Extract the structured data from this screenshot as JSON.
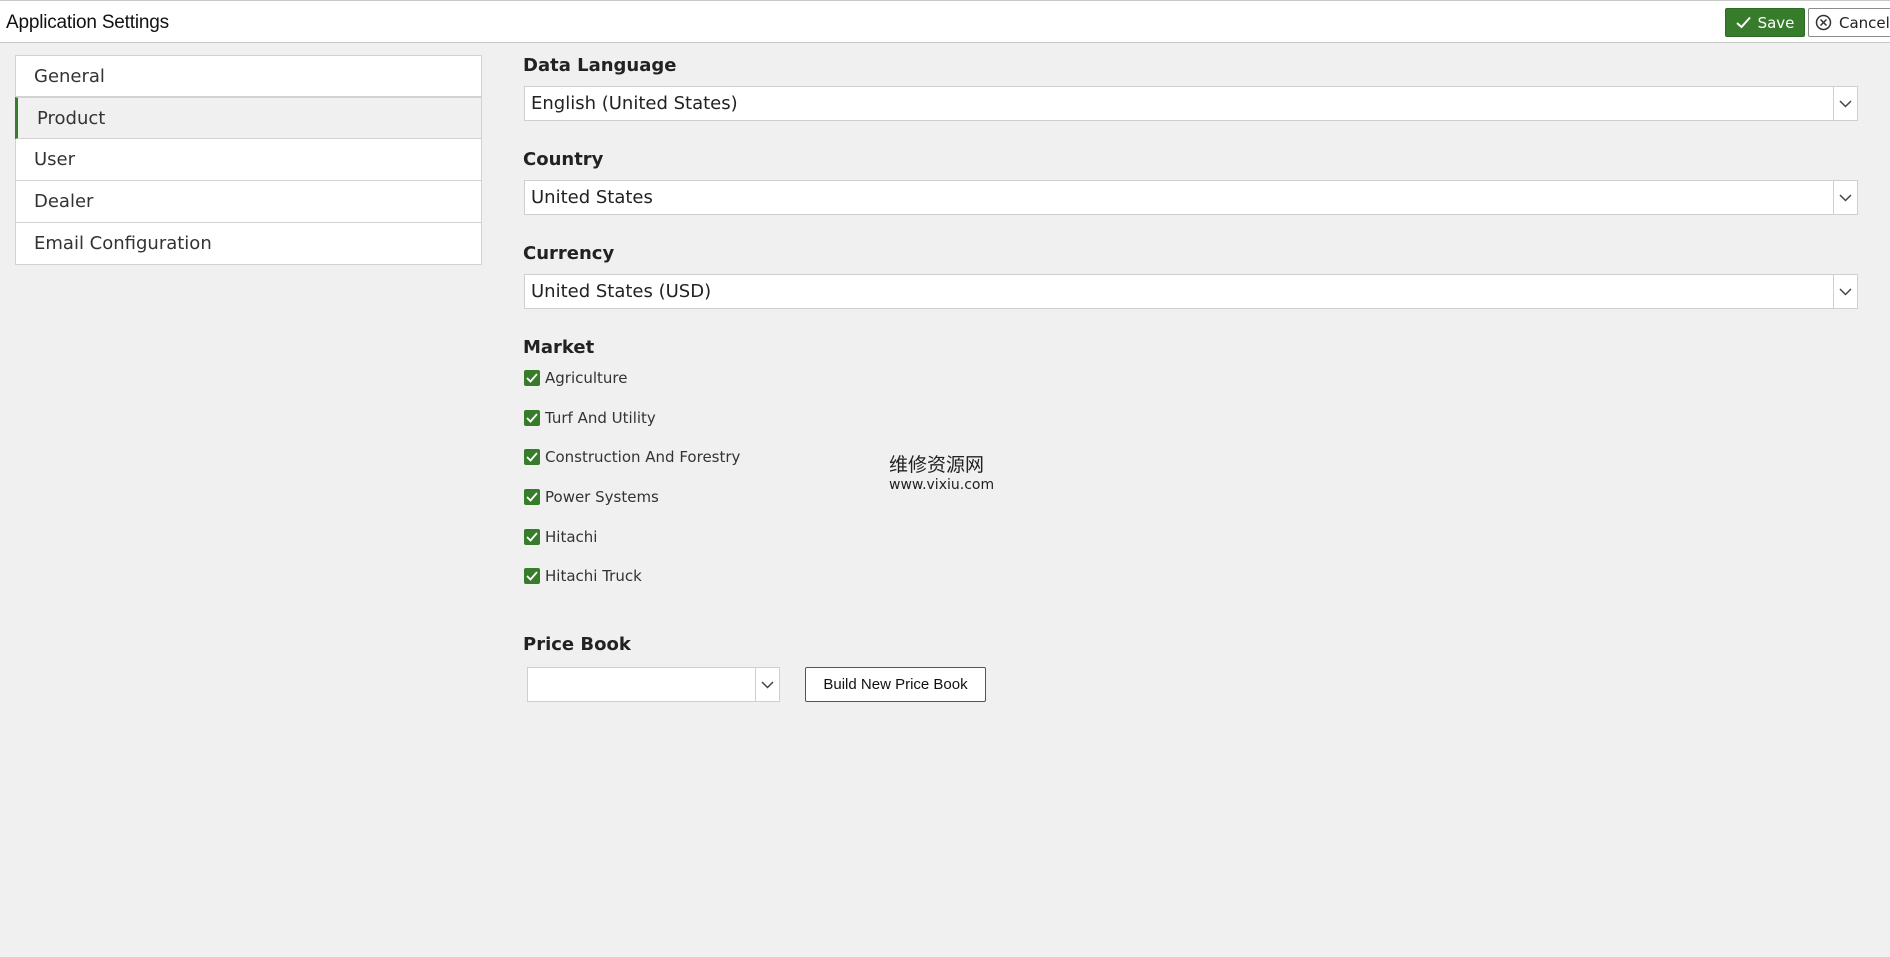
{
  "header": {
    "title": "Application Settings",
    "save_label": "Save",
    "cancel_label": "Cancel"
  },
  "sidebar": {
    "items": [
      {
        "label": "General"
      },
      {
        "label": "Product",
        "active": true
      },
      {
        "label": "User"
      },
      {
        "label": "Dealer"
      },
      {
        "label": "Email Configuration"
      }
    ]
  },
  "form": {
    "data_language": {
      "label": "Data Language",
      "value": "English (United States)"
    },
    "country": {
      "label": "Country",
      "value": "United States"
    },
    "currency": {
      "label": "Currency",
      "value": "United States (USD)"
    },
    "market": {
      "label": "Market",
      "options": [
        {
          "label": "Agriculture",
          "checked": true
        },
        {
          "label": "Turf And Utility",
          "checked": true
        },
        {
          "label": "Construction And Forestry",
          "checked": true
        },
        {
          "label": "Power Systems",
          "checked": true
        },
        {
          "label": "Hitachi",
          "checked": true
        },
        {
          "label": "Hitachi Truck",
          "checked": true
        }
      ]
    },
    "price_book": {
      "label": "Price Book",
      "value": "",
      "build_button_label": "Build New Price Book"
    }
  },
  "watermark": {
    "line1": "维修资源网",
    "line2": "www.vixiu.com"
  },
  "colors": {
    "accent": "#367c2b",
    "background": "#f0f0f0"
  },
  "icons": {
    "save": "check-icon",
    "cancel": "close-circle-icon",
    "dropdown": "chevron-down-icon",
    "checkbox": "checkbox-checked-icon"
  }
}
